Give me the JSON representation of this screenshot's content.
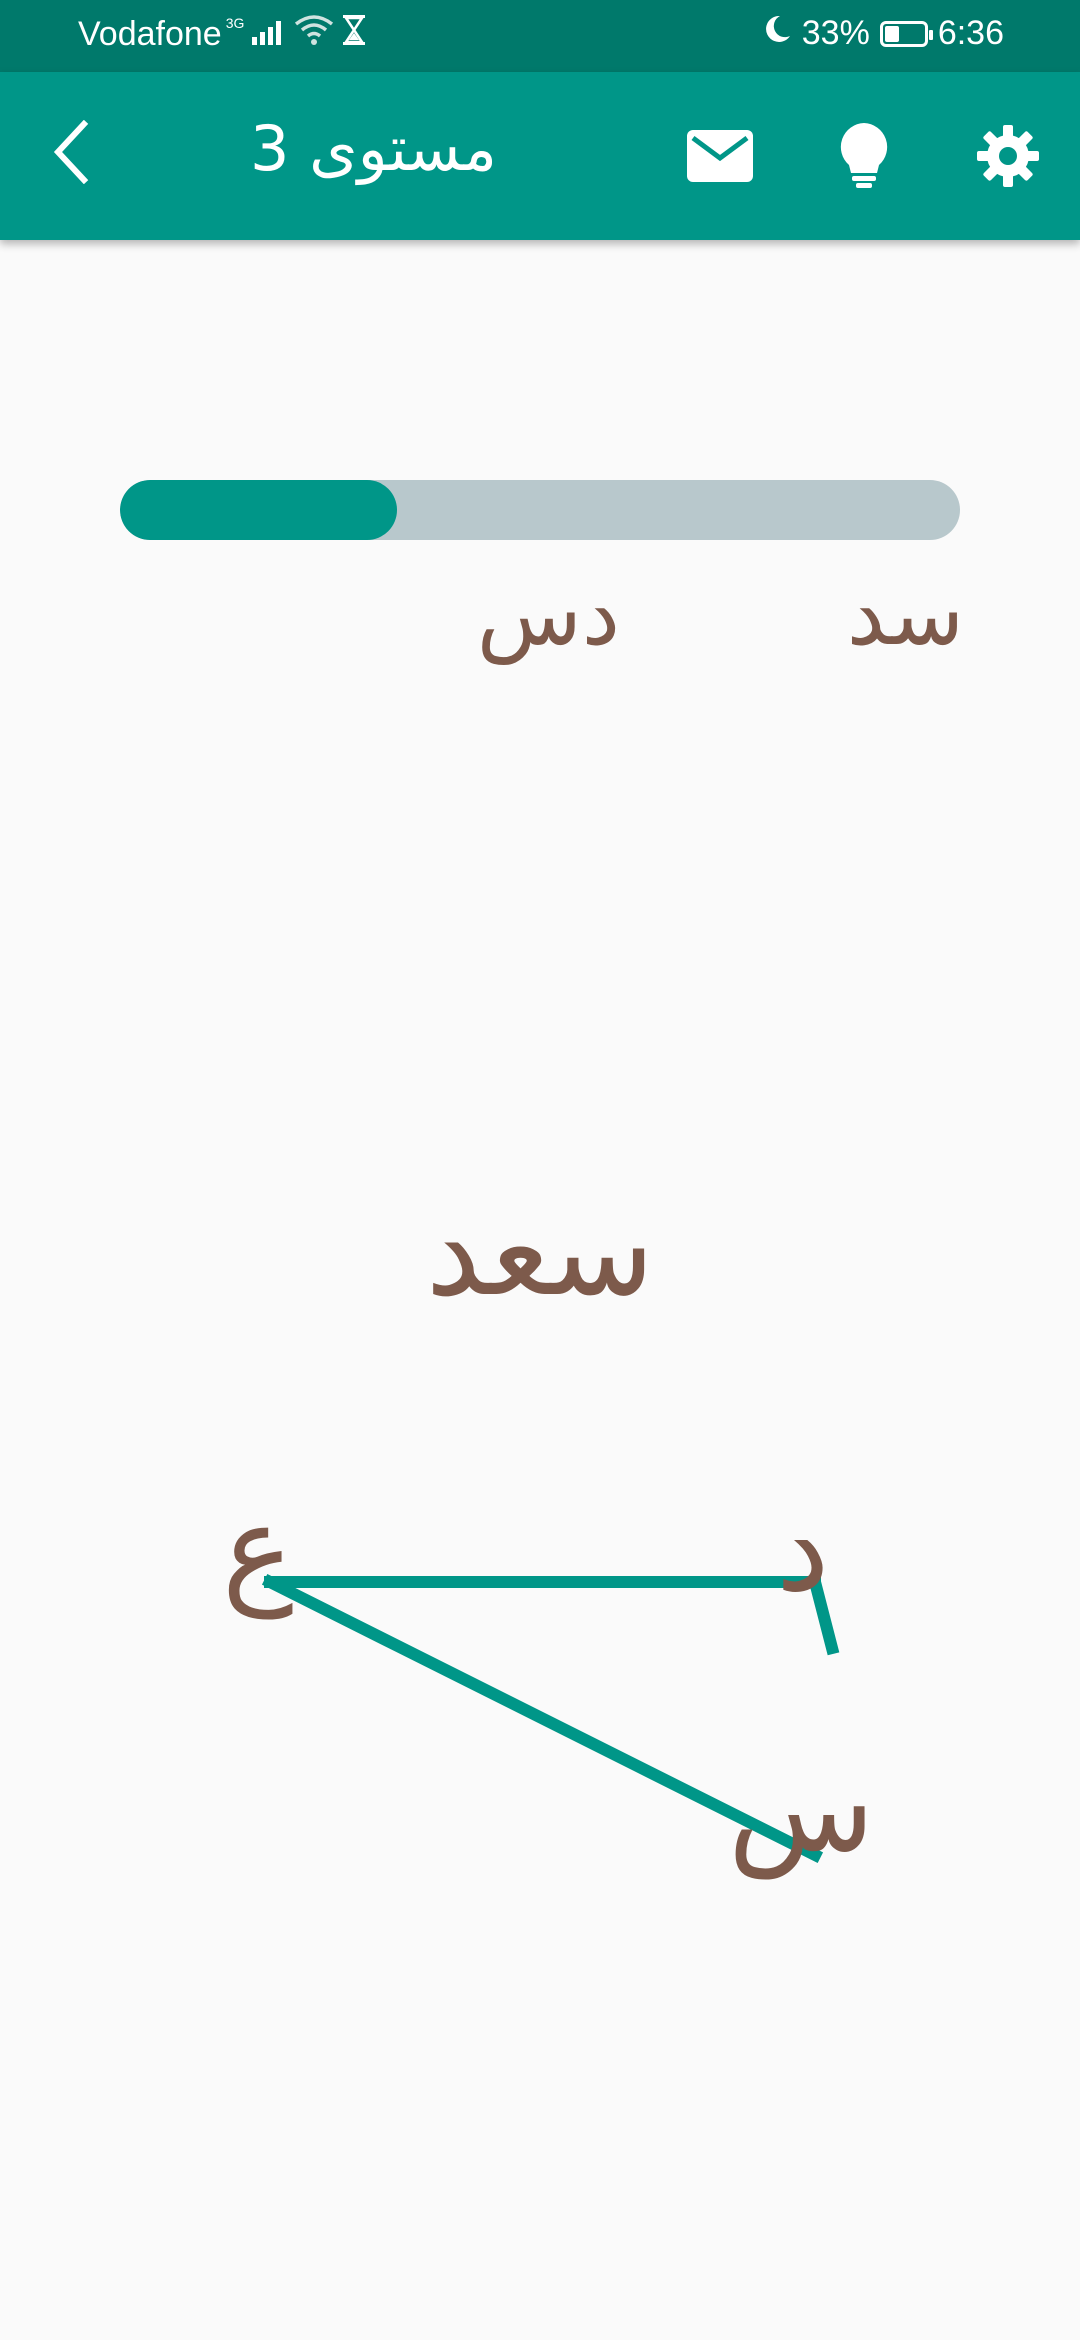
{
  "status_bar": {
    "carrier": "Vodafone",
    "network": "3G",
    "battery": "33%",
    "time": "6:36",
    "icons": [
      "signal-icon",
      "wifi-icon",
      "hourglass-icon",
      "moon-icon",
      "battery-icon"
    ]
  },
  "app_bar": {
    "title": "مستوى 3",
    "icons": [
      "back-arrow-icon",
      "mail-icon",
      "lightbulb-icon",
      "gear-icon"
    ]
  },
  "progress": {
    "value": 0.33
  },
  "found_words": [
    "سد",
    "دس"
  ],
  "target_word": "سعد",
  "letters": {
    "letter_1": "ع",
    "letter_2": "د",
    "letter_3": "س"
  },
  "colors": {
    "status_bar": "#00796b",
    "app_bar": "#009688",
    "accent": "#009688",
    "text": "#7d5a4b",
    "track": "#b8c8cc",
    "background": "#fafafa"
  }
}
